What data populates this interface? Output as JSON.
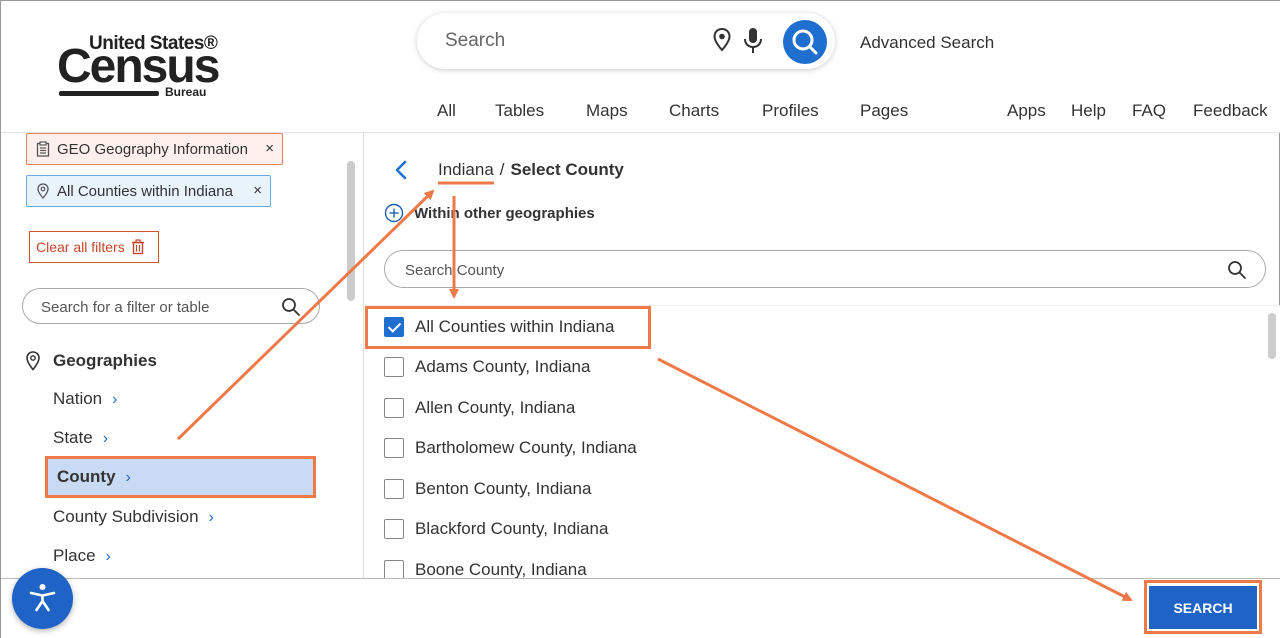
{
  "header": {
    "logo": {
      "line1": "United States®",
      "line2": "Census",
      "line3": "Bureau"
    },
    "search_placeholder": "Search",
    "advanced_search": "Advanced Search",
    "tabs": [
      "All",
      "Tables",
      "Maps",
      "Charts",
      "Profiles",
      "Pages"
    ],
    "utility_links": [
      "Apps",
      "Help",
      "FAQ",
      "Feedback"
    ]
  },
  "sidebar": {
    "chips": [
      {
        "label": "GEO Geography Information",
        "icon": "clipboard-icon"
      },
      {
        "label": "All Counties within Indiana",
        "icon": "map-pin-icon"
      }
    ],
    "chip_close": "×",
    "clear_all": "Clear all filters",
    "filter_search_placeholder": "Search for a filter or table",
    "geographies_heading": "Geographies",
    "geo_items": [
      "Nation",
      "State",
      "County",
      "County Subdivision",
      "Place"
    ],
    "chevron": "›"
  },
  "panel": {
    "breadcrumb_link": "Indiana",
    "breadcrumb_sep": "/",
    "breadcrumb_current": "Select County",
    "within_other": "Within other geographies",
    "county_search_placeholder": "Search County",
    "counties": [
      {
        "label": "All Counties within Indiana",
        "checked": true
      },
      {
        "label": "Adams County, Indiana",
        "checked": false
      },
      {
        "label": "Allen County, Indiana",
        "checked": false
      },
      {
        "label": "Bartholomew County, Indiana",
        "checked": false
      },
      {
        "label": "Benton County, Indiana",
        "checked": false
      },
      {
        "label": "Blackford County, Indiana",
        "checked": false
      },
      {
        "label": "Boone County, Indiana",
        "checked": false
      }
    ]
  },
  "footer": {
    "search_button": "SEARCH"
  },
  "colors": {
    "accent": "#1f6fd1",
    "annotation": "#ee7a4a",
    "selected_bg": "#c9daf5"
  }
}
